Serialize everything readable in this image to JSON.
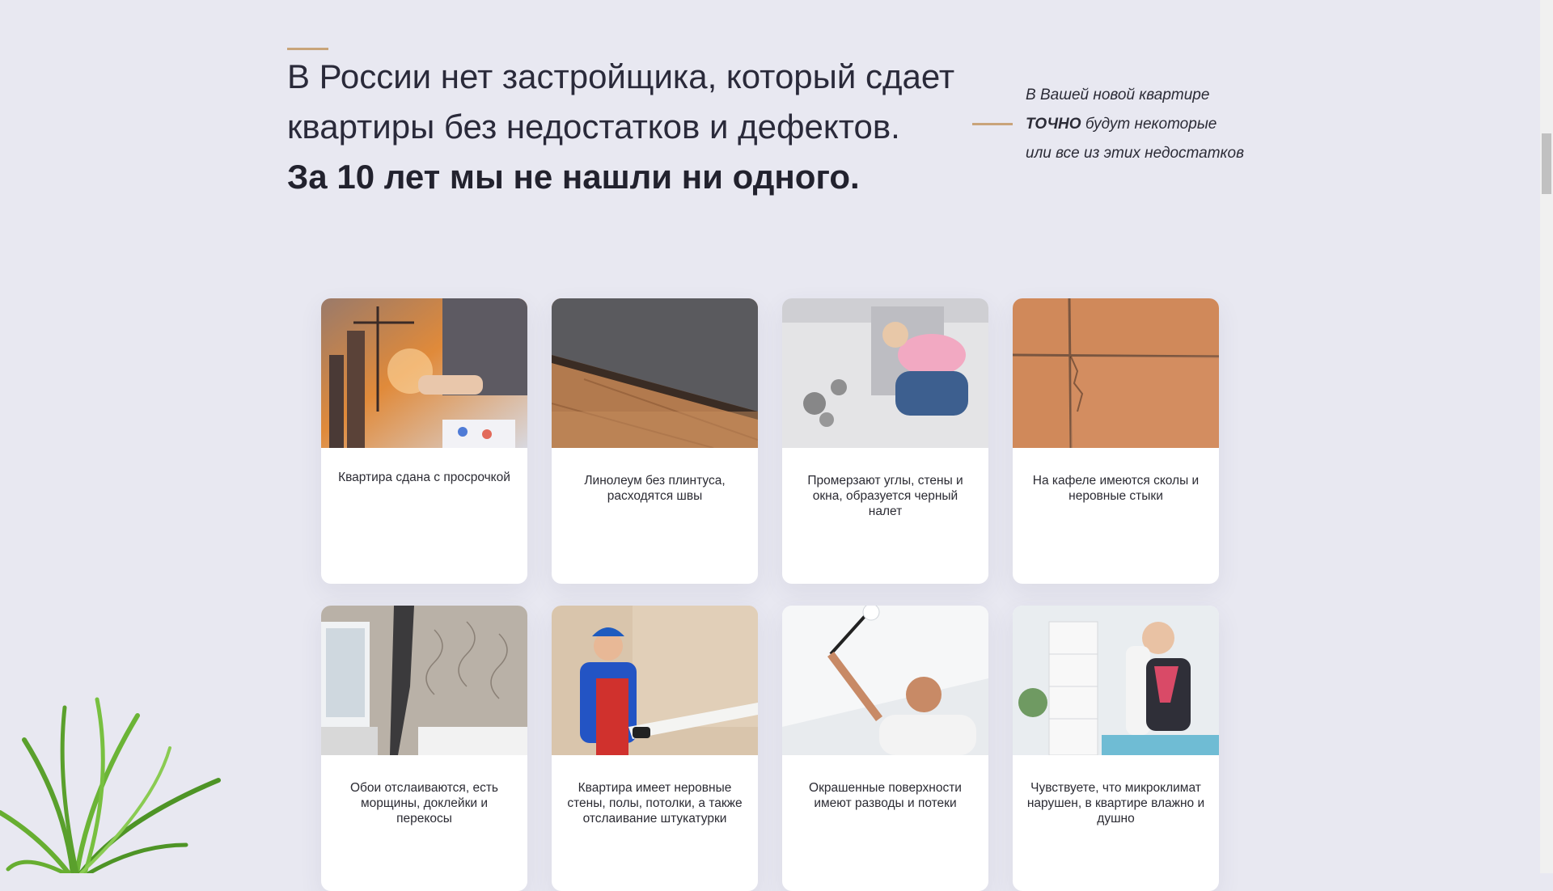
{
  "heading": {
    "line1": "В России нет застройщика, который сдает",
    "line2": "квартиры без недостатков и дефектов.",
    "line3": "За 10 лет мы не нашли ни одного."
  },
  "side_note": {
    "line1": "В Вашей новой квартире",
    "emphasis": "ТОЧНО",
    "line2_rest": "будут некоторые",
    "line3": "или все из этих недостатков"
  },
  "defects": [
    {
      "caption": "Квартира сдана с просрочкой",
      "photo": "construction-handshake-photo"
    },
    {
      "caption": "Линолеум без плинтуса, расходятся швы",
      "photo": "linoleum-floor-photo"
    },
    {
      "caption": "Промерзают углы, стены и окна, образуется черный налет",
      "photo": "mold-wall-photo"
    },
    {
      "caption": "На кафеле имеются сколы и неровные стыки",
      "photo": "cracked-tile-photo"
    },
    {
      "caption": "Обои отслаиваются, есть морщины, доклейки и перекосы",
      "photo": "peeling-wallpaper-photo"
    },
    {
      "caption": "Квартира имеет неровные стены, полы, потолки, а также отслаивание штукатурки",
      "photo": "plaster-worker-photo"
    },
    {
      "caption": "Окрашенные поверхности имеют разводы и потеки",
      "photo": "ceiling-painter-photo"
    },
    {
      "caption": "Чувствуете, что микроклимат нарушен, в квартире влажно и душно",
      "photo": "humid-room-woman-photo"
    }
  ],
  "colors": {
    "background": "#e8e8f1",
    "accent": "#c9a47a",
    "card": "#ffffff",
    "text": "#23232f"
  }
}
